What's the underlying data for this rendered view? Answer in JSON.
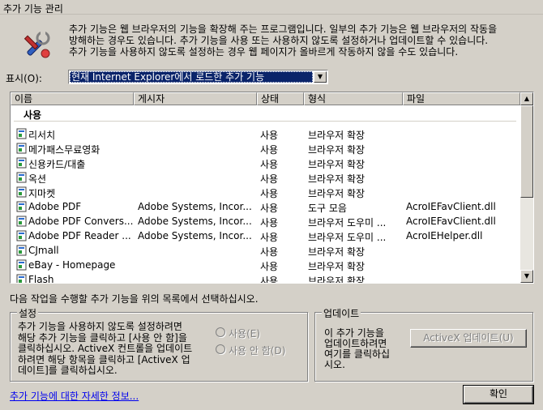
{
  "window": {
    "title": "추가 기능 관리"
  },
  "intro": {
    "lines": [
      "추가 기능은 웹 브라우저의 기능을 확장해 주는 프로그램입니다. 일부의 추가 기능은 웹 브라우저의 작동을",
      "방해하는 경우도 있습니다. 추가 기능을 사용 또는 사용하지 않도록 설정하거나 업데이트할 수 있습니다.",
      "추가 기능을 사용하지 않도록 설정하는 경우 웹 페이지가 올바르게 작동하지 않을 수도 있습니다."
    ]
  },
  "show": {
    "label": "표시(O):",
    "selected": "현재 Internet Explorer에서 로드한 추가 기능"
  },
  "list": {
    "columns": [
      "이름",
      "게시자",
      "상태",
      "형식",
      "파일"
    ],
    "group_header": "사용",
    "rows": [
      {
        "name": "리서치",
        "publisher": "",
        "status": "사용",
        "type": "브라우저 확장",
        "file": ""
      },
      {
        "name": "메가패스무료영화",
        "publisher": "",
        "status": "사용",
        "type": "브라우저 확장",
        "file": ""
      },
      {
        "name": "신용카드/대출",
        "publisher": "",
        "status": "사용",
        "type": "브라우저 확장",
        "file": ""
      },
      {
        "name": "옥션",
        "publisher": "",
        "status": "사용",
        "type": "브라우저 확장",
        "file": ""
      },
      {
        "name": "지마켓",
        "publisher": "",
        "status": "사용",
        "type": "브라우저 확장",
        "file": ""
      },
      {
        "name": "Adobe PDF",
        "publisher": "Adobe Systems, Incor...",
        "status": "사용",
        "type": "도구 모음",
        "file": "AcroIEFavClient.dll"
      },
      {
        "name": "Adobe PDF Convers...",
        "publisher": "Adobe Systems, Incor...",
        "status": "사용",
        "type": "브라우저 도우미 ...",
        "file": "AcroIEFavClient.dll"
      },
      {
        "name": "Adobe PDF Reader ...",
        "publisher": "Adobe Systems, Incor...",
        "status": "사용",
        "type": "브라우저 도우미 ...",
        "file": "AcroIEHelper.dll"
      },
      {
        "name": "CJmall",
        "publisher": "",
        "status": "사용",
        "type": "브라우저 확장",
        "file": ""
      },
      {
        "name": "eBay - Homepage",
        "publisher": "",
        "status": "사용",
        "type": "브라우저 확장",
        "file": ""
      },
      {
        "name": "Flash",
        "publisher": "",
        "status": "사용",
        "type": "브라우저 확장",
        "file": ""
      }
    ]
  },
  "hint": "다음 작업을 수행할 추가 기능을 위의 목록에서 선택하십시오.",
  "settings": {
    "legend": "설정",
    "lines": [
      "추가 기능을 사용하지 않도록 설정하려면",
      "해당 추가 기능을 클릭하고 [사용 안 함]을",
      "클릭하십시오. ActiveX 컨트롤을 업데이트",
      "하려면 해당 항목을 클릭하고 [ActiveX 업",
      "데이트]를 클릭하십시오."
    ],
    "radio_enable": "사용(E)",
    "radio_disable": "사용 안 함(D)"
  },
  "update": {
    "legend": "업데이트",
    "lines": [
      "이 추가 기능을",
      "업데이트하려면",
      "여기를 클릭하십",
      "시오."
    ],
    "button": "ActiveX 업데이트(U)"
  },
  "footer": {
    "link": "추가 기능에 대한 자세한 정보...",
    "ok": "확인"
  }
}
